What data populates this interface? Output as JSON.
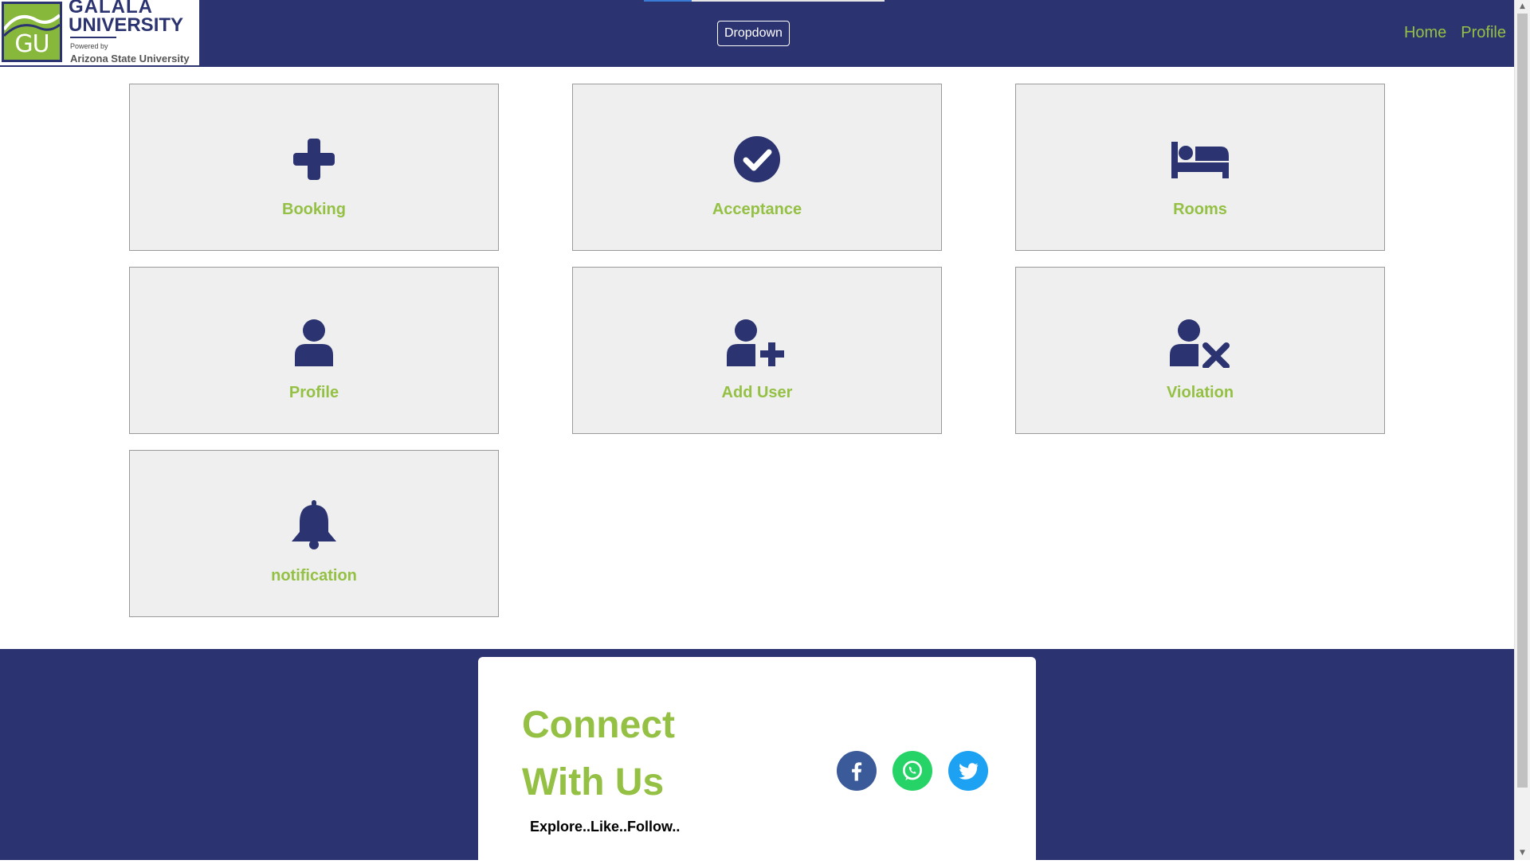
{
  "header": {
    "logo": {
      "mark_letters": "GU",
      "name_line1": "GALALA",
      "name_line2": "UNIVERSITY",
      "powered_by": "Powered by",
      "partner": "Arizona State University"
    },
    "dropdown_label": "Dropdown",
    "nav": [
      {
        "label": "Home"
      },
      {
        "label": "Profile"
      }
    ]
  },
  "cards": [
    {
      "label": "Booking",
      "icon": "plus-icon"
    },
    {
      "label": "Acceptance",
      "icon": "check-circle-icon"
    },
    {
      "label": "Rooms",
      "icon": "bed-icon"
    },
    {
      "label": "Profile",
      "icon": "user-icon"
    },
    {
      "label": "Add User",
      "icon": "user-plus-icon"
    },
    {
      "label": "Violation",
      "icon": "user-x-icon"
    },
    {
      "label": "notification",
      "icon": "bell-icon"
    }
  ],
  "footer": {
    "title": "Connect With Us",
    "subtitle": "Explore..Like..Follow..",
    "social": [
      {
        "name": "facebook-icon",
        "color": "#3b5a9a"
      },
      {
        "name": "whatsapp-icon",
        "color": "#25d366"
      },
      {
        "name": "twitter-icon",
        "color": "#1da1f2"
      }
    ]
  },
  "colors": {
    "primary": "#2b3370",
    "accent": "#94c044",
    "card_bg": "#efefef"
  }
}
